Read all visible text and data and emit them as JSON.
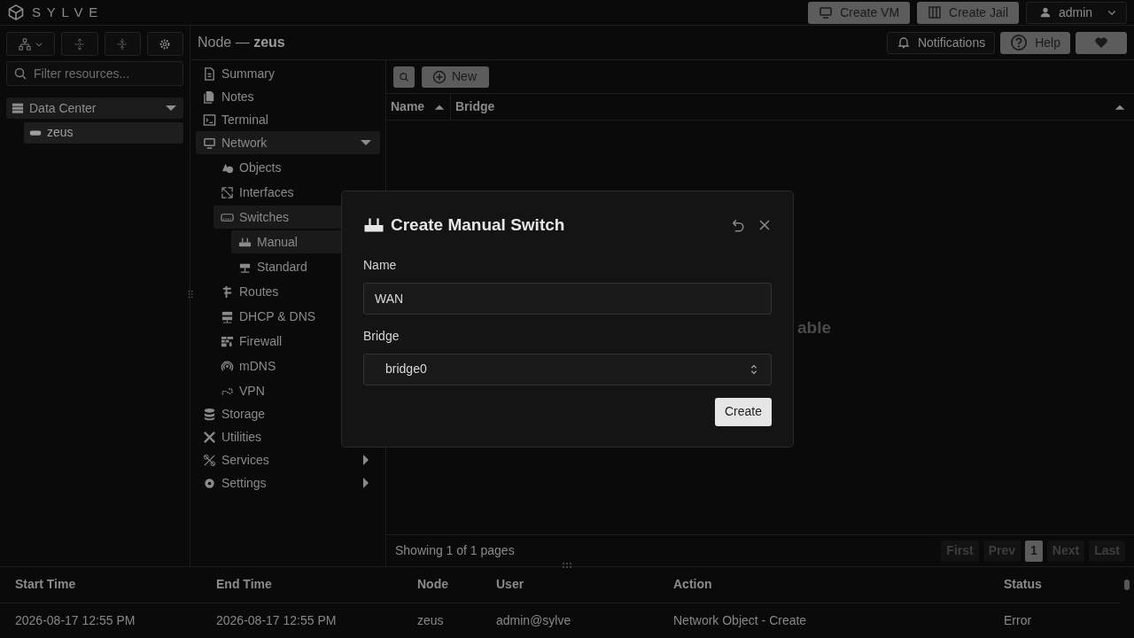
{
  "brand": "SYLVE",
  "header_buttons": [
    {
      "kind": "vm",
      "label": "Create VM"
    },
    {
      "kind": "jail",
      "label": "Create Jail"
    }
  ],
  "user_menu": {
    "label": "admin"
  },
  "sidebar": {
    "filter_placeholder": "Filter resources...",
    "tree": [
      {
        "label": "Data Center",
        "kind": "datacenter",
        "expanded": true,
        "children": [
          {
            "label": "zeus",
            "kind": "node",
            "selected": true
          }
        ]
      }
    ]
  },
  "breadcrumb": "Node — **zeus**",
  "top_actions": [
    {
      "kind": "bell",
      "label": "Notifications"
    },
    {
      "kind": "help",
      "label": "Help"
    },
    {
      "kind": "heart"
    }
  ],
  "nav": [
    {
      "label": "Summary"
    },
    {
      "label": "Notes"
    },
    {
      "label": "Terminal"
    },
    {
      "label": "Network",
      "expanded": true,
      "children": [
        {
          "label": "Objects"
        },
        {
          "label": "Interfaces"
        },
        {
          "label": "Switches",
          "expanded": true,
          "children": [
            {
              "label": "Manual",
              "selected": true
            },
            {
              "label": "Standard",
              "selected": false
            }
          ]
        },
        {
          "label": "Routes"
        },
        {
          "label": "DHCP & DNS"
        },
        {
          "label": "Firewall"
        },
        {
          "label": "mDNS"
        },
        {
          "label": "VPN"
        }
      ]
    },
    {
      "label": "Storage"
    },
    {
      "label": "Utilities"
    },
    {
      "label": "Services",
      "expanded": false
    },
    {
      "label": "Settings",
      "expanded": false
    }
  ],
  "toolbar": {
    "new_label": "New"
  },
  "table": {
    "columns": [
      {
        "label": "Name",
        "sorted": true
      },
      {
        "label": "Bridge",
        "sorted": false
      }
    ],
    "empty_text_visible": "able"
  },
  "pager": {
    "summary": "Showing 1 of 1 pages",
    "buttons": [
      {
        "label": "First",
        "disabled": true,
        "selected": false
      },
      {
        "label": "Prev",
        "disabled": true,
        "selected": false
      },
      {
        "label": "1",
        "disabled": false,
        "selected": true
      },
      {
        "label": "Next",
        "disabled": true,
        "selected": false
      },
      {
        "label": "Last",
        "disabled": true,
        "selected": false
      }
    ]
  },
  "audit": {
    "columns": [
      "Start Time",
      "End Time",
      "Node",
      "User",
      "Action",
      "Status"
    ],
    "rows": [
      [
        "2026-08-17 12:55 PM",
        "2026-08-17 12:55 PM",
        "zeus",
        "admin@sylve",
        "Network Object - Create",
        "Error"
      ]
    ]
  },
  "dialog": {
    "title": "Create Manual Switch",
    "fields": [
      {
        "kind": "text",
        "label": "Name",
        "value": "WAN"
      },
      {
        "kind": "select",
        "label": "Bridge",
        "value": "bridge0"
      }
    ],
    "submit": "Create"
  }
}
